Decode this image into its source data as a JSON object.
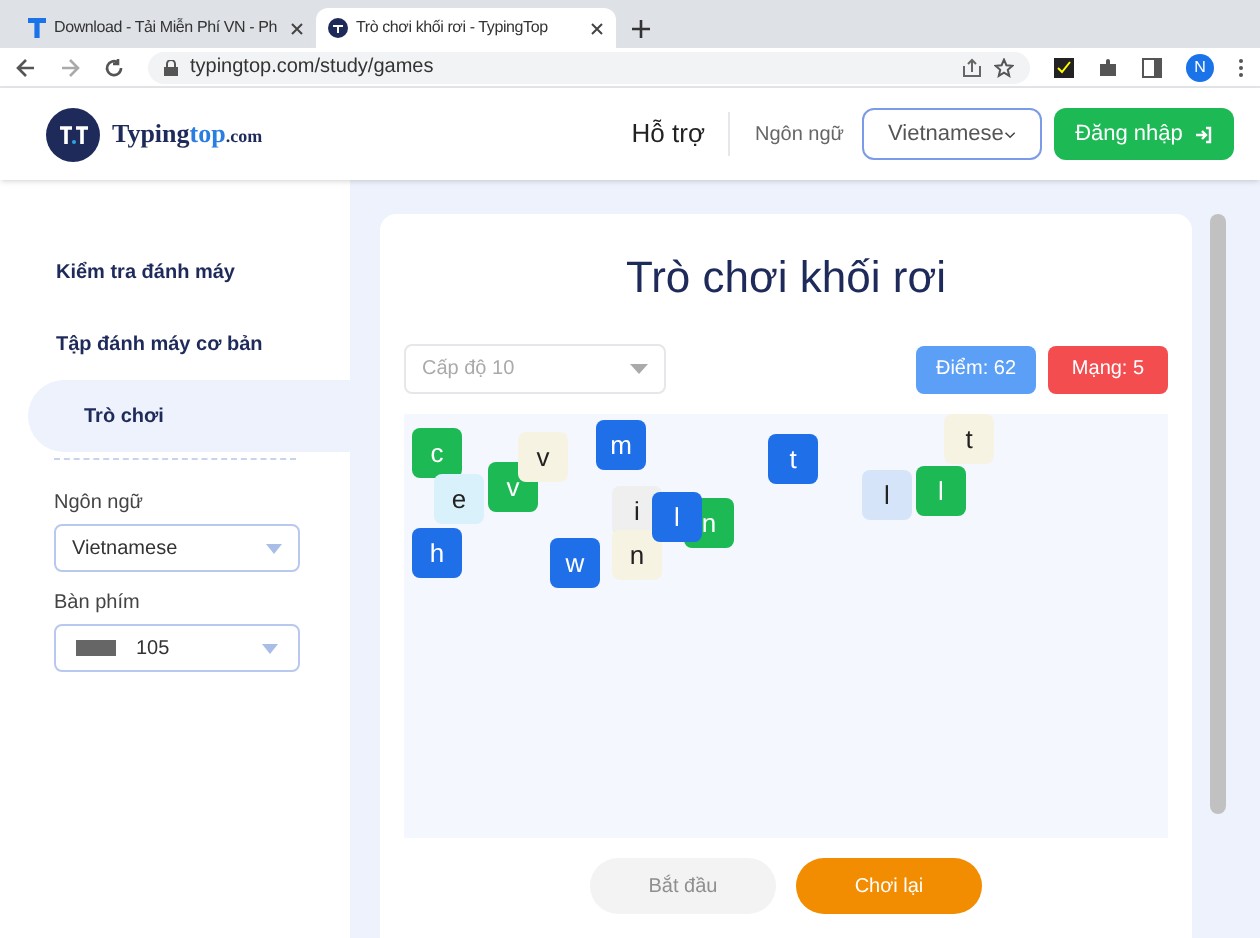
{
  "browser": {
    "tabs": [
      {
        "title": "Download - Tải Miễn Phí VN - Ph",
        "selected": false
      },
      {
        "title": "Trò chơi khối rơi - TypingTop",
        "selected": true
      }
    ],
    "url": "typingtop.com/study/games",
    "profile": "N"
  },
  "header": {
    "logo_main": "Typing",
    "logo_accent": "top",
    "logo_suffix": ".com",
    "help": "Hỗ trợ",
    "language_label": "Ngôn ngữ",
    "language_value": "Vietnamese",
    "login": "Đăng nhập"
  },
  "sidebar": {
    "items": [
      {
        "label": "Kiểm tra đánh máy",
        "selected": false
      },
      {
        "label": "Tập đánh máy cơ bản",
        "selected": false
      },
      {
        "label": "Trò chơi",
        "selected": true
      }
    ],
    "language_label": "Ngôn ngữ",
    "language_value": "Vietnamese",
    "keyboard_label": "Bàn phím",
    "keyboard_value": "105"
  },
  "game": {
    "title": "Trò chơi khối rơi",
    "level": "Cấp độ 10",
    "score": "Điểm: 62",
    "lives": "Mạng: 5",
    "blocks": [
      {
        "letter": "c",
        "color": "#1db954"
      },
      {
        "letter": "v",
        "color": "#f7f3e3"
      },
      {
        "letter": "m",
        "color": "#1f6fe8"
      },
      {
        "letter": "t",
        "color": "#1f6fe8"
      },
      {
        "letter": "t",
        "color": "#f7f3e3"
      },
      {
        "letter": "e",
        "color": "#d9f1fb"
      },
      {
        "letter": "v",
        "color": "#1db954"
      },
      {
        "letter": "i",
        "color": "#efefef"
      },
      {
        "letter": "l",
        "color": "#1f6fe8"
      },
      {
        "letter": "n",
        "color": "#1db954"
      },
      {
        "letter": "l",
        "color": "#d6e4fa"
      },
      {
        "letter": "l",
        "color": "#1db954"
      },
      {
        "letter": "h",
        "color": "#1f6fe8"
      },
      {
        "letter": "w",
        "color": "#1f6fe8"
      },
      {
        "letter": "n",
        "color": "#f7f3e3"
      }
    ],
    "start": {
      "label": "Bắt đầu",
      "disabled": true
    },
    "replay": {
      "label": "Chơi lại",
      "disabled": false
    }
  }
}
